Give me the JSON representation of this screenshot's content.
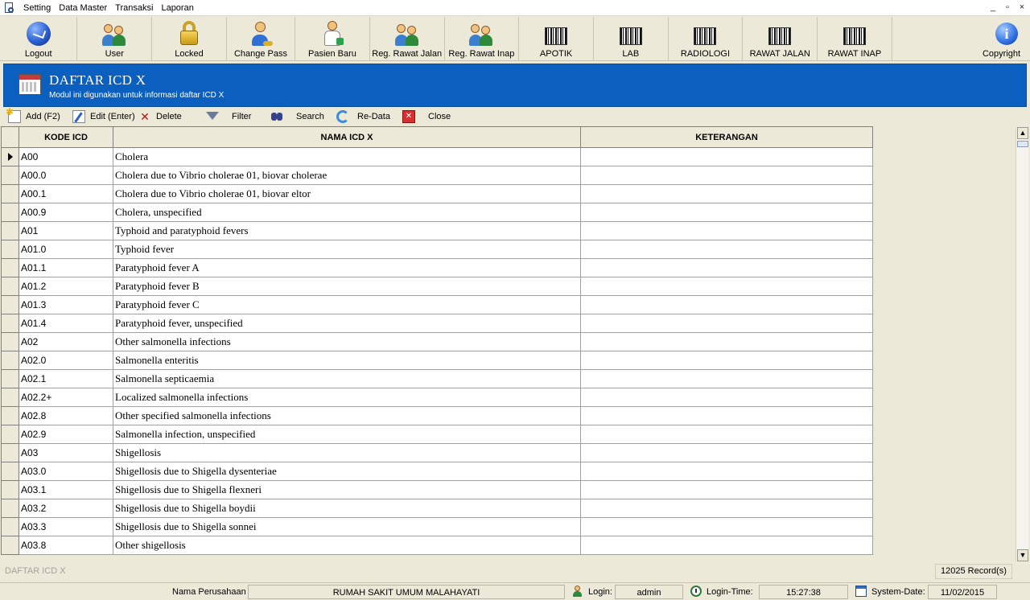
{
  "menu": {
    "items": [
      "Setting",
      "Data Master",
      "Transaksi",
      "Laporan"
    ],
    "window_controls": [
      "_",
      "▫",
      "×"
    ]
  },
  "toolbar": [
    {
      "label": "Logout",
      "icon": "logout-icon"
    },
    {
      "label": "User",
      "icon": "user-icon"
    },
    {
      "label": "Locked",
      "icon": "lock-icon"
    },
    {
      "label": "Change Pass",
      "icon": "user-key-icon"
    },
    {
      "label": "Pasien Baru",
      "icon": "doctor-icon"
    },
    {
      "label": "Reg. Rawat Jalan",
      "icon": "users-icon"
    },
    {
      "label": "Reg. Rawat Inap",
      "icon": "users-icon"
    },
    {
      "label": "APOTIK",
      "icon": "barcode-icon"
    },
    {
      "label": "LAB",
      "icon": "barcode-icon"
    },
    {
      "label": "RADIOLOGI",
      "icon": "barcode-icon"
    },
    {
      "label": "RAWAT JALAN",
      "icon": "barcode-icon"
    },
    {
      "label": "RAWAT INAP",
      "icon": "barcode-icon"
    },
    {
      "label": "Copyright",
      "icon": "info-icon"
    }
  ],
  "module": {
    "title": "DAFTAR ICD X",
    "subtitle": "Modul ini digunakan untuk informasi daftar ICD X",
    "accent": "#0a5fbf"
  },
  "actions": {
    "add": "Add (F2)",
    "edit": "Edit (Enter)",
    "delete": "Delete",
    "filter": "Filter",
    "search": "Search",
    "redata": "Re-Data",
    "close": "Close"
  },
  "grid": {
    "columns": [
      "KODE ICD",
      "NAMA ICD X",
      "KETERANGAN"
    ],
    "rows": [
      {
        "code": "A00",
        "name": "Cholera",
        "note": ""
      },
      {
        "code": "A00.0",
        "name": "Cholera due to Vibrio cholerae 01, biovar cholerae",
        "note": ""
      },
      {
        "code": "A00.1",
        "name": "Cholera due to Vibrio cholerae 01, biovar eltor",
        "note": ""
      },
      {
        "code": "A00.9",
        "name": "Cholera, unspecified",
        "note": ""
      },
      {
        "code": "A01",
        "name": "Typhoid and paratyphoid fevers",
        "note": ""
      },
      {
        "code": "A01.0",
        "name": "Typhoid fever",
        "note": ""
      },
      {
        "code": "A01.1",
        "name": "Paratyphoid fever A",
        "note": ""
      },
      {
        "code": "A01.2",
        "name": "Paratyphoid fever B",
        "note": ""
      },
      {
        "code": "A01.3",
        "name": "Paratyphoid fever C",
        "note": ""
      },
      {
        "code": "A01.4",
        "name": "Paratyphoid fever, unspecified",
        "note": ""
      },
      {
        "code": "A02",
        "name": "Other salmonella infections",
        "note": ""
      },
      {
        "code": "A02.0",
        "name": "Salmonella enteritis",
        "note": ""
      },
      {
        "code": "A02.1",
        "name": "Salmonella septicaemia",
        "note": ""
      },
      {
        "code": "A02.2+",
        "name": "Localized salmonella infections",
        "note": ""
      },
      {
        "code": "A02.8",
        "name": "Other specified salmonella infections",
        "note": ""
      },
      {
        "code": "A02.9",
        "name": "Salmonella infection, unspecified",
        "note": ""
      },
      {
        "code": "A03",
        "name": "Shigellosis",
        "note": ""
      },
      {
        "code": "A03.0",
        "name": "Shigellosis due to Shigella dysenteriae",
        "note": ""
      },
      {
        "code": "A03.1",
        "name": "Shigellosis due to Shigella flexneri",
        "note": ""
      },
      {
        "code": "A03.2",
        "name": "Shigellosis due to Shigella boydii",
        "note": ""
      },
      {
        "code": "A03.3",
        "name": "Shigellosis due to Shigella sonnei",
        "note": ""
      },
      {
        "code": "A03.8",
        "name": "Other shigellosis",
        "note": ""
      }
    ]
  },
  "footer": {
    "module_name": "DAFTAR ICD X",
    "records": "12025 Record(s)"
  },
  "status": {
    "company_label": "Nama Perusahaan",
    "company": "RUMAH SAKIT UMUM MALAHAYATI",
    "login_label": "Login:",
    "login": "admin",
    "login_time_label": "Login-Time:",
    "login_time": "15:27:38",
    "system_date_label": "System-Date:",
    "system_date": "11/02/2015"
  }
}
